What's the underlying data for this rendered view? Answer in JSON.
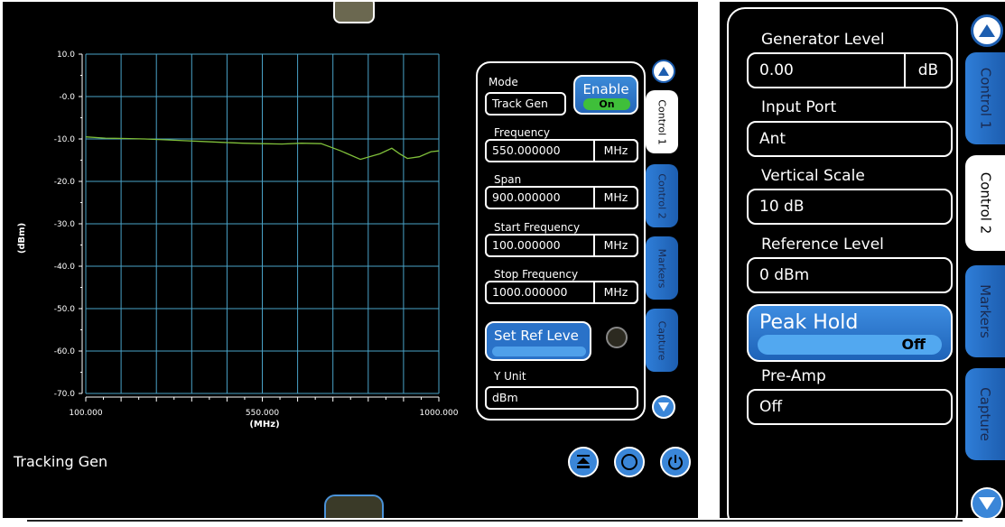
{
  "left": {
    "app_title": "Tracking Gen",
    "chart": {
      "ylabel": "(dBm)",
      "xlabel": "(MHz)"
    },
    "control": {
      "mode_label": "Mode",
      "mode_value": "Track Gen",
      "enable_label": "Enable",
      "enable_state": "On",
      "frequency_label": "Frequency",
      "frequency_value": "550.000000",
      "frequency_unit": "MHz",
      "span_label": "Span",
      "span_value": "900.000000",
      "span_unit": "MHz",
      "start_label": "Start Frequency",
      "start_value": "100.000000",
      "start_unit": "MHz",
      "stop_label": "Stop Frequency",
      "stop_value": "1000.000000",
      "stop_unit": "MHz",
      "setref_label": "Set Ref Leve",
      "yunit_label": "Y Unit",
      "yunit_value": "dBm"
    },
    "tabs": [
      "Control 1",
      "Control 2",
      "Markers",
      "Capture"
    ]
  },
  "right": {
    "generator_level_label": "Generator Level",
    "generator_level_value": "0.00",
    "generator_level_unit": "dB",
    "input_port_label": "Input Port",
    "input_port_value": "Ant",
    "vertical_scale_label": "Vertical Scale",
    "vertical_scale_value": "10 dB",
    "reference_level_label": "Reference Level",
    "reference_level_value": "0 dBm",
    "peak_hold_label": "Peak Hold",
    "peak_hold_state": "Off",
    "preamp_label": "Pre-Amp",
    "preamp_value": "Off",
    "tabs": [
      "Control 1",
      "Control 2",
      "Markers",
      "Capture"
    ]
  },
  "colors": {
    "trace": "#7fbf3a",
    "grid": "#4aa3c8",
    "accent": "#2f7ed8"
  },
  "chart_data": {
    "type": "line",
    "xlabel": "(MHz)",
    "ylabel": "(dBm)",
    "xlim": [
      100,
      1000
    ],
    "ylim": [
      -70,
      10
    ],
    "x_tick_labels": [
      "100.000",
      "550.000",
      "1000.000"
    ],
    "y_tick_labels": [
      "10.0",
      "-0.0",
      "-10.0",
      "-20.0",
      "-30.0",
      "-40.0",
      "-50.0",
      "-60.0",
      "-70.0"
    ],
    "grid": true,
    "series": [
      {
        "x": [
          100,
          150,
          200,
          250,
          300,
          350,
          400,
          450,
          500,
          550,
          600,
          650,
          700,
          750,
          800,
          850,
          880,
          900,
          920,
          950,
          980,
          1000
        ],
        "values": [
          -9.5,
          -9.8,
          -9.9,
          -10.0,
          -10.2,
          -10.4,
          -10.6,
          -10.8,
          -11.0,
          -11.1,
          -11.2,
          -11.0,
          -11.1,
          -12.8,
          -14.8,
          -13.5,
          -12.2,
          -13.5,
          -14.6,
          -14.2,
          -13.0,
          -12.8
        ]
      }
    ]
  }
}
